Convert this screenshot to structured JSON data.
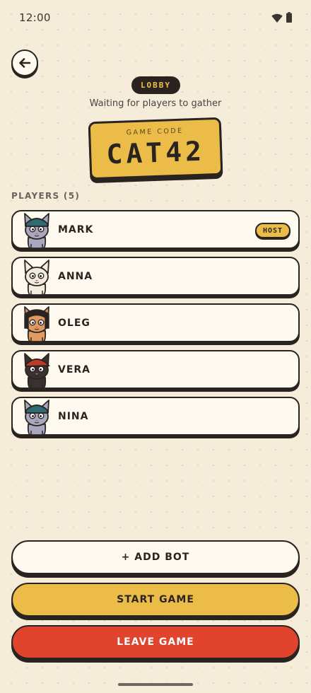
{
  "status_bar": {
    "time": "12:00",
    "wifi_icon": "wifi-icon",
    "battery_icon": "battery-icon"
  },
  "header": {
    "back_icon": "arrow-left-icon",
    "badge": "LOBBY",
    "subtitle": "Waiting for players to gather"
  },
  "game_code": {
    "label": "GAME CODE",
    "value": "CAT42"
  },
  "players": {
    "heading": "PLAYERS (5)",
    "items": [
      {
        "name": "MARK",
        "badge": "HOST",
        "avatar": "cat-avatar-gray-beanie",
        "colors": {
          "fur": "#a9a7c0",
          "accent": "#2f6b75"
        }
      },
      {
        "name": "ANNA",
        "avatar": "cat-avatar-white",
        "colors": {
          "fur": "#f2ecdc",
          "accent": "#f2ecdc"
        }
      },
      {
        "name": "OLEG",
        "avatar": "cat-avatar-orange-hood",
        "colors": {
          "fur": "#e09a62",
          "accent": "#2a2421"
        }
      },
      {
        "name": "VERA",
        "avatar": "cat-avatar-black-red-cap",
        "colors": {
          "fur": "#3a3230",
          "accent": "#c0392b"
        }
      },
      {
        "name": "NINA",
        "avatar": "cat-avatar-gray-beanie",
        "colors": {
          "fur": "#a9a7c0",
          "accent": "#2f6b75"
        }
      }
    ]
  },
  "actions": {
    "add_bot": "+ ADD BOT",
    "start_game": "START GAME",
    "leave_game": "LEAVE GAME"
  },
  "theme": {
    "background": "#f5ecda",
    "ink": "#2a2421",
    "accent_yellow": "#ebbd48",
    "danger_red": "#e0442d"
  }
}
